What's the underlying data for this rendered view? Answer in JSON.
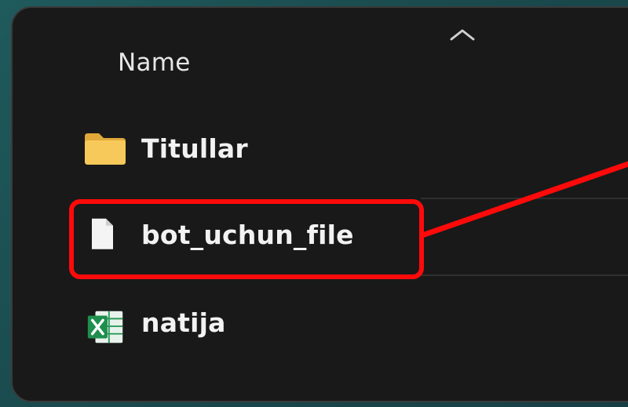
{
  "file_list": {
    "column_header": "Name",
    "sort_direction": "ascending",
    "items": [
      {
        "label": "Titullar",
        "icon": "folder-icon",
        "type": "folder"
      },
      {
        "label": "bot_uchun_file",
        "icon": "file-icon",
        "type": "file",
        "highlighted": true
      },
      {
        "label": "natija",
        "icon": "excel-file-icon",
        "type": "spreadsheet"
      }
    ]
  },
  "colors": {
    "background": "#1f5a5c",
    "window": "#191919",
    "highlight": "#ff0a0a",
    "folder": "#f2c14e",
    "excel": "#1e8f4e"
  }
}
